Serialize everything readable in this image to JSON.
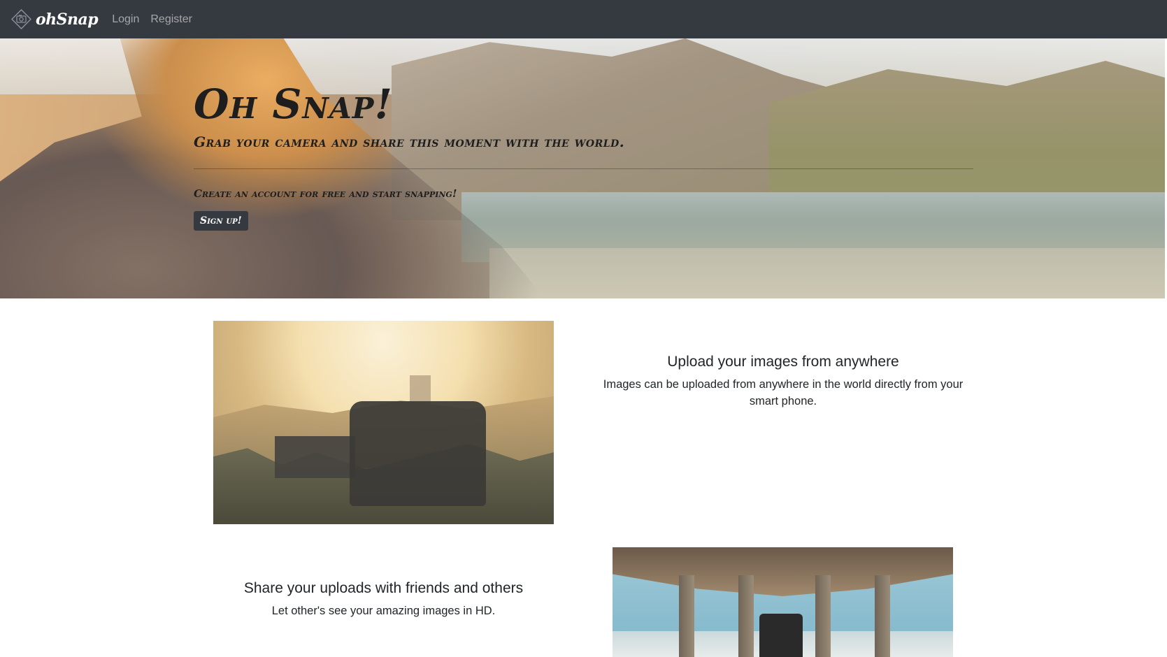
{
  "navbar": {
    "brand": "ohSnap",
    "links": [
      "Login",
      "Register"
    ]
  },
  "hero": {
    "title": "Oh Snap!",
    "lead": "Grab your camera and share this moment with the world.",
    "subtext": "Create an account for free and start snapping!",
    "button_label": "Sign up!"
  },
  "features": [
    {
      "heading": "Upload your images from anywhere",
      "text": "Images can be uploaded from anywhere in the world directly from your smart phone."
    },
    {
      "heading": "Share your uploads with friends and others",
      "text": "Let other's see your amazing images in HD."
    }
  ],
  "colors": {
    "navbar_bg": "#343a40",
    "button_bg": "#343a40",
    "nav_link": "rgba(255,255,255,0.55)"
  },
  "icons": {
    "brand_logo": "camera-logo-icon"
  }
}
